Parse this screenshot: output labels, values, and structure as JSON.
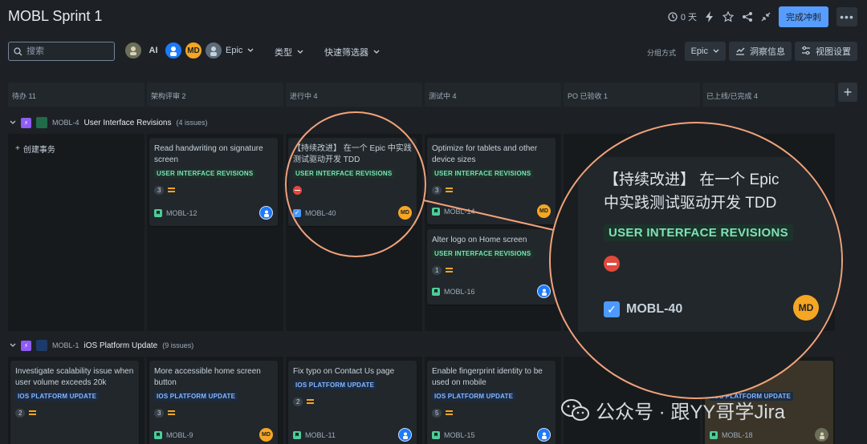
{
  "header": {
    "title": "MOBL Sprint 1",
    "timer": "0 天",
    "complete_sprint": "完成冲刺",
    "more": "•••"
  },
  "filters": {
    "search_placeholder": "搜索",
    "avatar_ai": "AI",
    "avatar_md": "MD",
    "epic": "Epic",
    "type": "类型",
    "quick_filters": "快速筛选器",
    "group_by_label": "分组方式",
    "group_by_value": "Epic",
    "insights": "洞察信息",
    "view_settings": "视图设置"
  },
  "columns": [
    {
      "name": "待办 11"
    },
    {
      "name": "架构评审 2"
    },
    {
      "name": "进行中 4"
    },
    {
      "name": "测试中 4"
    },
    {
      "name": "PO 已验收 1"
    },
    {
      "name": "已上线/已完成 4"
    }
  ],
  "swimlanes": [
    {
      "key": "MOBL-4",
      "title": "User Interface Revisions",
      "count": "(4 issues)"
    },
    {
      "key": "MOBL-1",
      "title": "iOS Platform Update",
      "count": "(9 issues)"
    }
  ],
  "create_issue": "创建事务",
  "cards": [
    {
      "title": "Read handwriting on signature screen",
      "label": "USER INTERFACE REVISIONS",
      "estimate": "3",
      "key": "MOBL-12"
    },
    {
      "title": "【持续改进】 在一个 Epic 中实践测试驱动开发 TDD",
      "label": "USER INTERFACE REVISIONS",
      "key": "MOBL-40",
      "avatar": "MD"
    },
    {
      "title": "Optimize for tablets and other device sizes",
      "label": "USER INTERFACE REVISIONS",
      "estimate": "3",
      "key": "MOBL-14",
      "avatar": "MD"
    },
    {
      "title": "Alter logo on Home screen",
      "label": "USER INTERFACE REVISIONS",
      "estimate": "1",
      "key": "MOBL-16"
    },
    {
      "title": "Investigate scalability issue when user volume exceeds 20k",
      "label": "IOS PLATFORM UPDATE",
      "estimate": "2"
    },
    {
      "title": "More accessible home screen button",
      "label": "IOS PLATFORM UPDATE",
      "estimate": "3",
      "key": "MOBL-9",
      "avatar": "MD"
    },
    {
      "title": "Fix typo on Contact Us page",
      "label": "IOS PLATFORM UPDATE",
      "estimate": "2",
      "key": "MOBL-11"
    },
    {
      "title": "Enable fingerprint identity to be used on mobile",
      "label": "IOS PLATFORM UPDATE",
      "estimate": "5",
      "key": "MOBL-15"
    },
    {
      "title": "de",
      "label": "IOS PLATFORM UPDATE",
      "key": "MOBL-18"
    }
  ],
  "zoom": {
    "title_line1": "【持续改进】 在一个 Epic",
    "title_line2": "中实践测试驱动开发 TDD",
    "label": "USER INTERFACE REVISIONS",
    "key": "MOBL-40",
    "avatar": "MD"
  },
  "watermark": "公众号 · 跟YY哥学Jira",
  "colors": {
    "accent": "#579dff",
    "highlight_circle": "#f2a27a",
    "epic_purple": "#8f5cf5",
    "story_green": "#4bce97",
    "priority_medium": "#f5a623",
    "blocker_red": "#e2483d"
  }
}
